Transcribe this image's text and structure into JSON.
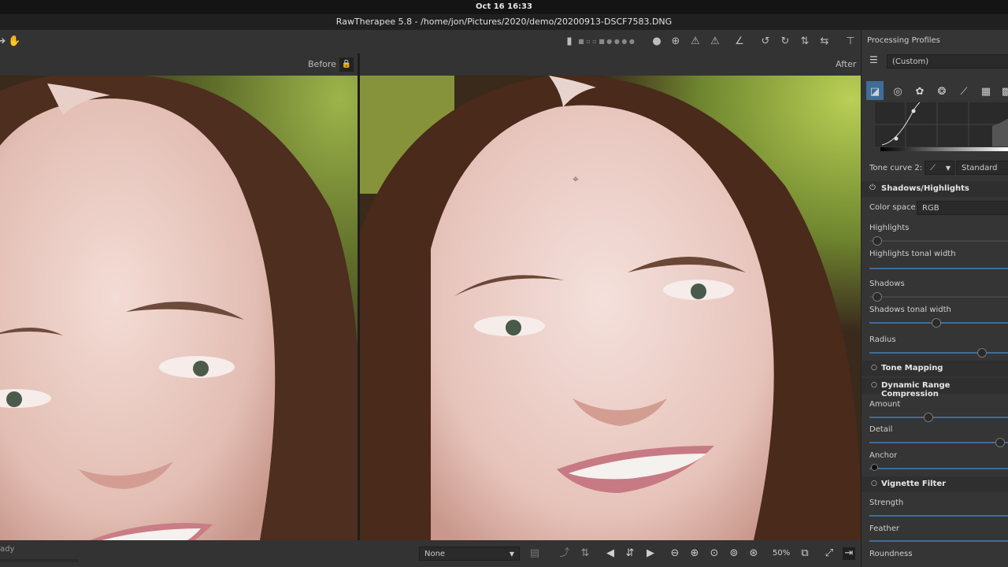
{
  "system": {
    "clock": "Oct 16  16:33"
  },
  "window": {
    "title": "RawTherapee 5.8 - /home/jon/Pictures/2020/demo/20200913-DSCF7583.DNG"
  },
  "preview": {
    "before_label": "Before",
    "after_label": "After"
  },
  "status": {
    "text": "ady"
  },
  "bottom": {
    "snapshot_value": "None",
    "zoom": "50%"
  },
  "panel": {
    "header": "Processing Profiles",
    "profile": "(Custom)",
    "tone_curve_label": "Tone curve 2:",
    "tone_curve_value": "Standard",
    "shadows_highlights": {
      "title": "Shadows/Highlights",
      "color_space_label": "Color space:",
      "color_space_value": "RGB",
      "highlights": "Highlights",
      "highlights_tonal_width": "Highlights tonal width",
      "shadows": "Shadows",
      "shadows_tonal_width": "Shadows tonal width",
      "radius": "Radius"
    },
    "tone_mapping": {
      "title": "Tone Mapping"
    },
    "drc": {
      "title": "Dynamic Range Compression",
      "amount": "Amount",
      "detail": "Detail",
      "anchor": "Anchor"
    },
    "vignette": {
      "title": "Vignette Filter",
      "strength": "Strength",
      "feather": "Feather",
      "roundness": "Roundness"
    }
  },
  "colors": {
    "accent": "#3f6d9a",
    "bg": "#2b2b2b",
    "panel": "#353535"
  }
}
